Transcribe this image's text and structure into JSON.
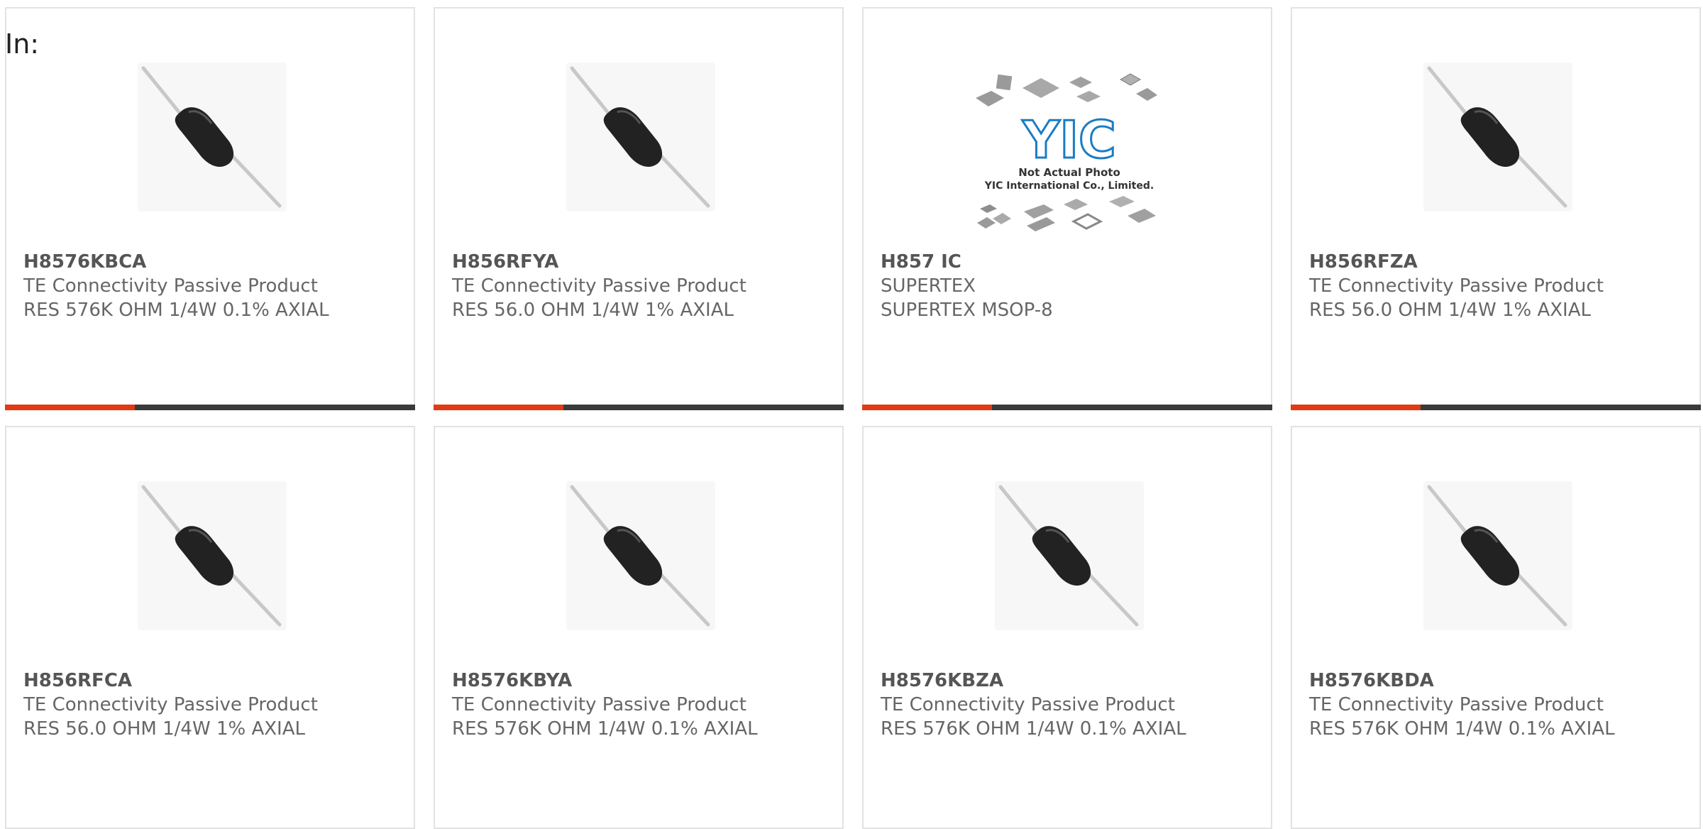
{
  "filter_label": "In:",
  "products": [
    {
      "part_number": "H8576KBCA",
      "manufacturer": "TE Connectivity Passive Product",
      "description": "RES 576K OHM 1/4W 0.1% AXIAL",
      "image": "axial-resistor-photo",
      "image_alt": ""
    },
    {
      "part_number": "H856RFYA",
      "manufacturer": "TE Connectivity Passive Product",
      "description": "RES 56.0 OHM 1/4W 1% AXIAL",
      "image": "axial-resistor-photo",
      "image_alt": ""
    },
    {
      "part_number": "H857 IC",
      "manufacturer": "SUPERTEX",
      "description": "SUPERTEX MSOP-8",
      "image": "placeholder-photo",
      "image_alt": "",
      "placeholder": {
        "logo_text": "YIC",
        "line1": "Not Actual Photo",
        "line2": "YIC International Co., Limited."
      }
    },
    {
      "part_number": "H856RFZA",
      "manufacturer": "TE Connectivity Passive Product",
      "description": "RES 56.0 OHM 1/4W 1% AXIAL",
      "image": "axial-resistor-photo",
      "image_alt": ""
    },
    {
      "part_number": "H856RFCA",
      "manufacturer": "TE Connectivity Passive Product",
      "description": "RES 56.0 OHM 1/4W 1% AXIAL",
      "image": "axial-resistor-photo",
      "image_alt": ""
    },
    {
      "part_number": "H8576KBYA",
      "manufacturer": "TE Connectivity Passive Product",
      "description": "RES 576K OHM 1/4W 0.1% AXIAL",
      "image": "axial-resistor-photo",
      "image_alt": ""
    },
    {
      "part_number": "H8576KBZA",
      "manufacturer": "TE Connectivity Passive Product",
      "description": "RES 576K OHM 1/4W 0.1% AXIAL",
      "image": "axial-resistor-photo",
      "image_alt": ""
    },
    {
      "part_number": "H8576KBDA",
      "manufacturer": "TE Connectivity Passive Product",
      "description": "RES 576K OHM 1/4W 0.1% AXIAL",
      "image": "axial-resistor-photo",
      "image_alt": ""
    }
  ],
  "colors": {
    "accent": "#e23a13",
    "bar": "#3a3a3a",
    "text": "#666666",
    "title": "#555555",
    "logo_blue": "#1a7cc4"
  }
}
